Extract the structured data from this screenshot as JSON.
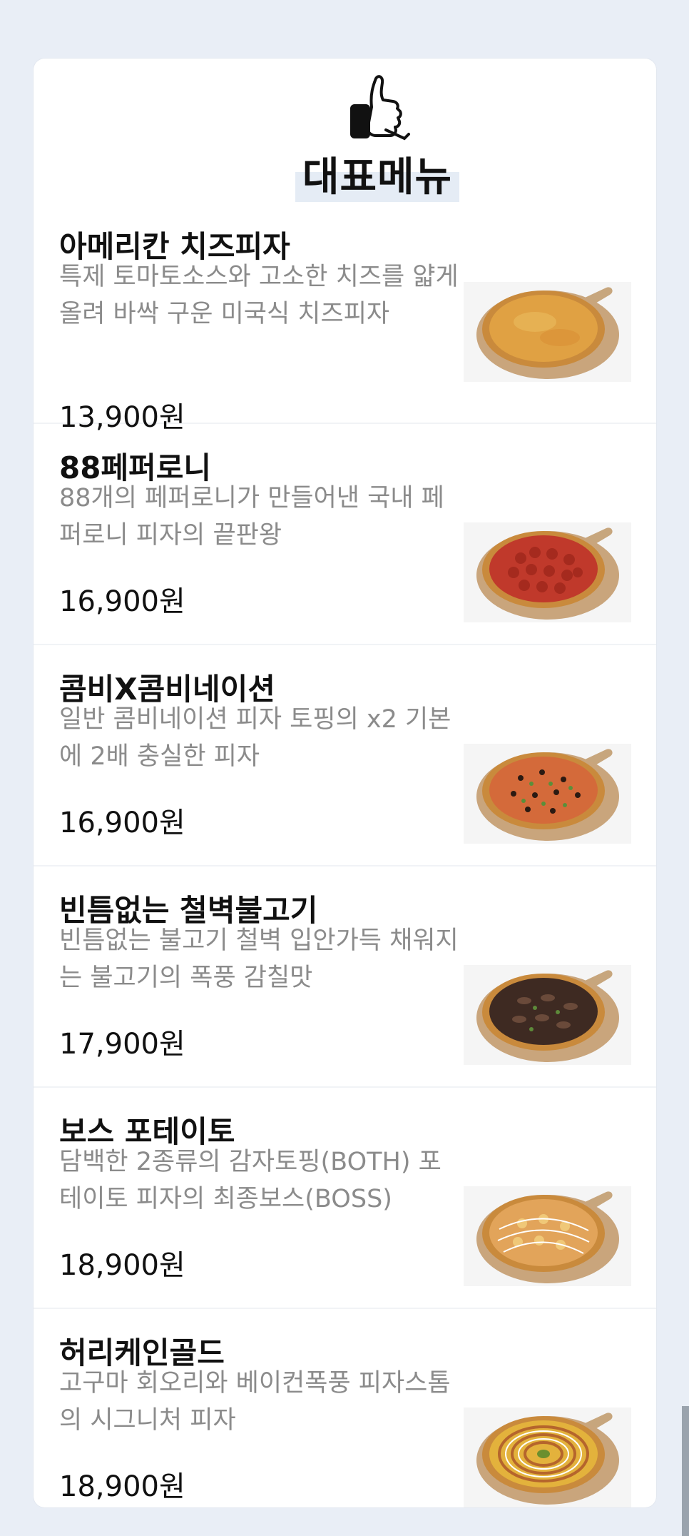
{
  "section": {
    "title": "대표메뉴",
    "icon": "thumbs-up-icon"
  },
  "menu_items": [
    {
      "name": "아메리칸 치즈피자",
      "desc": "특제 토마토소스와 고소한 치즈를 얇게 올려 바싹 구운 미국식 치즈피자",
      "price": "13,900원",
      "topping": "cheese"
    },
    {
      "name": "88페퍼로니",
      "desc": "88개의 페퍼로니가 만들어낸 국내 페퍼로니 피자의 끝판왕",
      "price": "16,900원",
      "topping": "pepperoni"
    },
    {
      "name": "콤비X콤비네이션",
      "desc": "일반 콤비네이션 피자 토핑의 x2 기본에 2배 충실한 피자",
      "price": "16,900원",
      "topping": "combination"
    },
    {
      "name": "빈틈없는 철벽불고기",
      "desc": "빈틈없는 불고기 철벽 입안가득 채워지는 불고기의 폭풍 감칠맛",
      "price": "17,900원",
      "topping": "bulgogi"
    },
    {
      "name": "보스 포테이토",
      "desc": "담백한 2종류의 감자토핑(BOTH) 포테이토 피자의 최종보스(BOSS)",
      "price": "18,900원",
      "topping": "potato"
    },
    {
      "name": "허리케인골드",
      "desc": "고구마 회오리와 베이컨폭풍 피자스톰의 시그니처 피자",
      "price": "18,900원",
      "topping": "hurricane"
    }
  ],
  "colors": {
    "background": "#e9eef6",
    "card": "#ffffff",
    "title_highlight": "#e5ecf5",
    "desc_text": "#8b8b8b"
  }
}
